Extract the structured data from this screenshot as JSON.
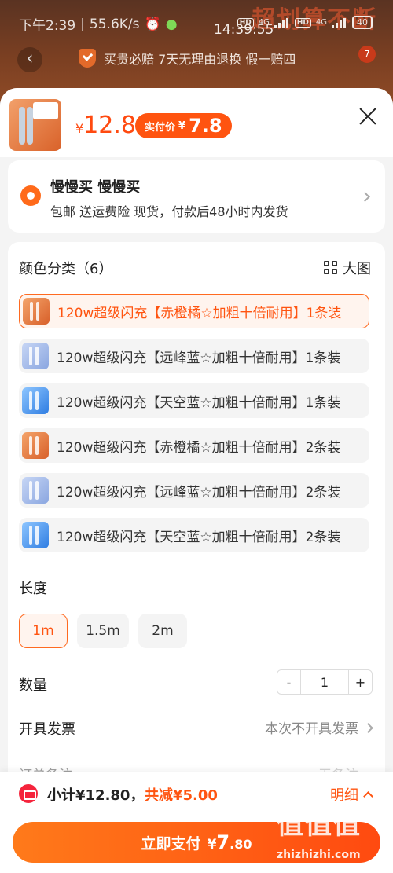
{
  "status_bar": {
    "time": "下午2:39",
    "speed": "55.6K/s",
    "clock_overlay": "14:39:55",
    "net_4g_a": "4G",
    "hd_a": "HD",
    "net_4g_b": "4G",
    "hd_b": "HD",
    "battery": "40"
  },
  "background": {
    "banner": "超划算不断",
    "guarantee": "买贵必赔 7天无理由退换 假一赔四",
    "cart_badge": "7"
  },
  "product": {
    "price_symbol": "¥",
    "price": "12.8",
    "paid_label": "实付价",
    "paid_symbol": "¥",
    "paid_value": "7.8"
  },
  "address": {
    "name": "慢慢买 慢慢买",
    "detail": "包邮  送运费险  现货，付款后48小时内发货"
  },
  "color_section": {
    "title": "颜色分类（6）",
    "big_image_label": "大图",
    "options": [
      {
        "label": "120w超级闪充【赤橙橘☆加粗十倍耐用】1条装",
        "selected": true
      },
      {
        "label": "120w超级闪充【远峰蓝☆加粗十倍耐用】1条装",
        "selected": false
      },
      {
        "label": "120w超级闪充【天空蓝☆加粗十倍耐用】1条装",
        "selected": false
      },
      {
        "label": "120w超级闪充【赤橙橘☆加粗十倍耐用】2条装",
        "selected": false
      },
      {
        "label": "120w超级闪充【远峰蓝☆加粗十倍耐用】2条装",
        "selected": false
      },
      {
        "label": "120w超级闪充【天空蓝☆加粗十倍耐用】2条装",
        "selected": false
      }
    ]
  },
  "length_section": {
    "title": "长度",
    "options": [
      {
        "label": "1m",
        "selected": true
      },
      {
        "label": "1.5m",
        "selected": false
      },
      {
        "label": "2m",
        "selected": false
      }
    ]
  },
  "quantity": {
    "label": "数量",
    "minus": "-",
    "value": "1",
    "plus": "+"
  },
  "invoice": {
    "label": "开具发票",
    "value": "本次不开具发票"
  },
  "remark": {
    "label": "订单备注",
    "value": "无备注"
  },
  "footer": {
    "subtotal": "小计¥12.80，",
    "discount": "共减¥5.00",
    "detail_label": "明细",
    "pay_label": "立即支付",
    "pay_symbol": "¥",
    "pay_int": "7",
    "pay_dec": ".80"
  },
  "watermark": {
    "text": "值值值",
    "url": "zhizhizhi.com"
  },
  "colors": {
    "accent": "#ff5410",
    "selected_bg": "#fff4ee",
    "option_bg": "#f4f4f4"
  }
}
